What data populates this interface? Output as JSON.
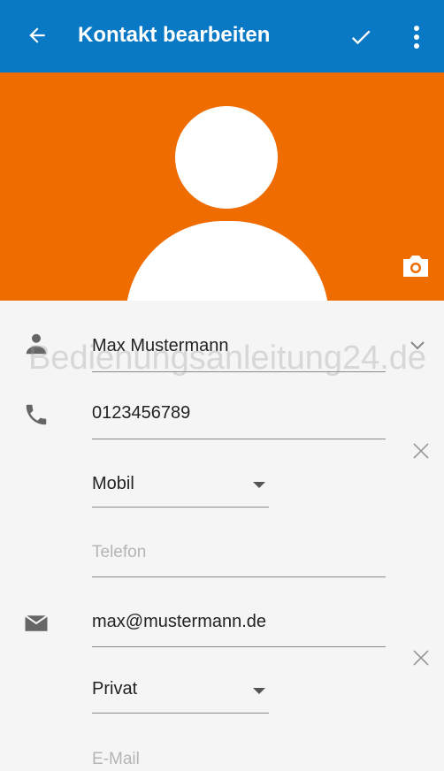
{
  "toolbar": {
    "title": "Kontakt bearbeiten",
    "color": "#0a79c5",
    "back_icon": "arrow-back-icon",
    "save_icon": "check-icon",
    "more_icon": "more-vert-icon"
  },
  "hero": {
    "color": "#ef6c00",
    "camera_icon": "camera-icon"
  },
  "form": {
    "name": {
      "value": "Max Mustermann",
      "icon": "person-icon",
      "expand_icon": "chevron-down-icon"
    },
    "phone": {
      "value": "0123456789",
      "type": "Mobil",
      "icon": "phone-icon"
    },
    "phone_new": {
      "placeholder": "Telefon"
    },
    "email": {
      "value": "max@mustermann.de",
      "type": "Privat",
      "icon": "email-icon"
    },
    "email_new": {
      "placeholder": "E-Mail"
    }
  },
  "watermark": "Bedienungsanleitung24.de"
}
